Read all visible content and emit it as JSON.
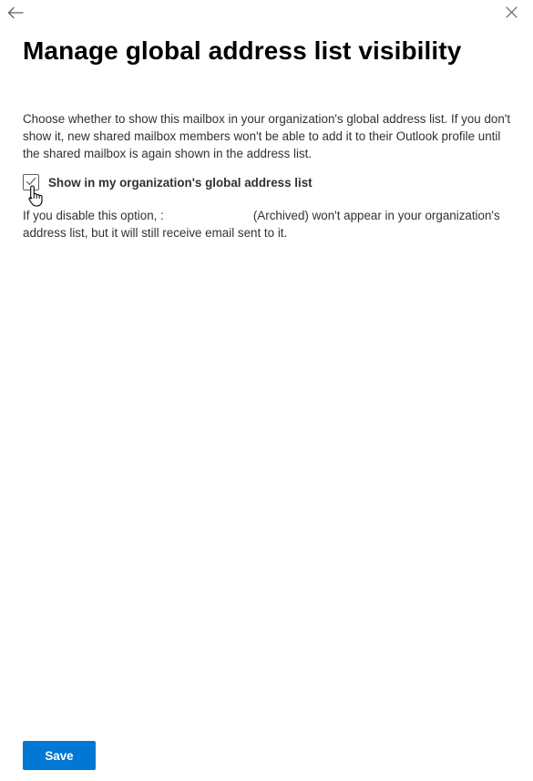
{
  "panel": {
    "title": "Manage global address list visibility",
    "description": "Choose whether to show this mailbox in your organization's global address list. If you don't show it, new shared mailbox members won't be able to add it to their Outlook profile until the shared mailbox is again shown in the address list.",
    "checkbox": {
      "label": "Show in my organization's global address list",
      "checked": true
    },
    "note": {
      "prefix": "If you disable this option, ",
      "redacted_marker": ":",
      "suffix": "(Archived) won't appear in your organization's address list, but it will still receive email sent to it."
    },
    "save_label": "Save"
  },
  "icons": {
    "back": "back-arrow-icon",
    "close": "close-icon",
    "check": "checkmark-icon",
    "cursor": "hand-pointer-icon"
  },
  "colors": {
    "primary": "#0078d4",
    "text": "#323130",
    "title": "#000000",
    "icon": "#605e5c"
  }
}
